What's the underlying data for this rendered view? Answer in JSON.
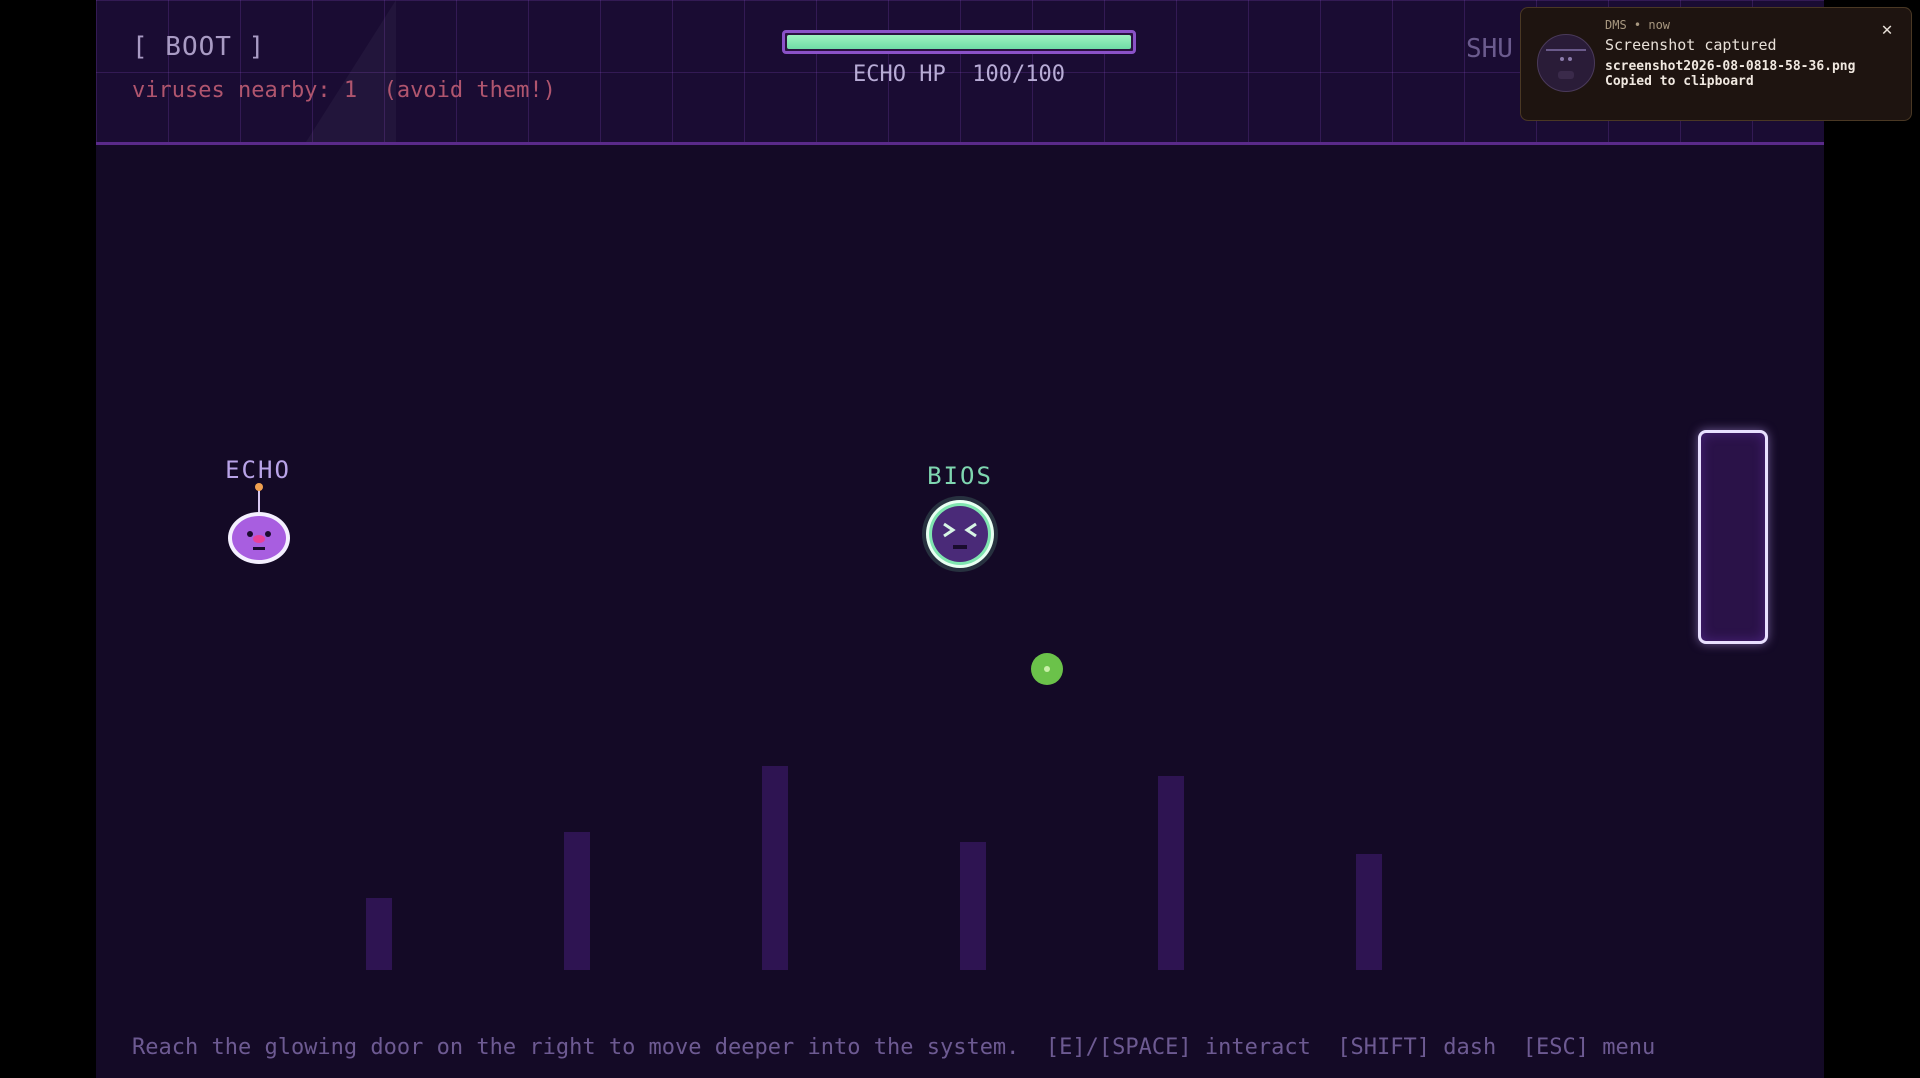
{
  "hud": {
    "boot_label": "[ BOOT ]",
    "virus_warning": "viruses nearby: 1  (avoid them!)",
    "shutdown_label_partial": "SHU",
    "hp_label": "ECHO HP  100/100",
    "hp_fraction": 1.0
  },
  "characters": {
    "echo": {
      "name": "ECHO"
    },
    "bios": {
      "name": "BIOS"
    }
  },
  "help_text": "Reach the glowing door on the right to move deeper into the system.  [E]/[SPACE] interact  [SHIFT] dash  [ESC] menu",
  "notification": {
    "app": "DMS",
    "time": "now",
    "meta": "DMS  •  now",
    "title": "Screenshot captured",
    "filename": "screenshot2026-08-0818-58-36.png",
    "clipboard": "Copied to clipboard",
    "close_icon": "close-icon"
  },
  "colors": {
    "hp_fill": "#7fe5b0",
    "echo_body": "#b06be8",
    "bios_ring": "#7fe5b0",
    "orb": "#6bc24a",
    "door_glow": "#e8e0ff",
    "virus_text": "#b0556e"
  }
}
